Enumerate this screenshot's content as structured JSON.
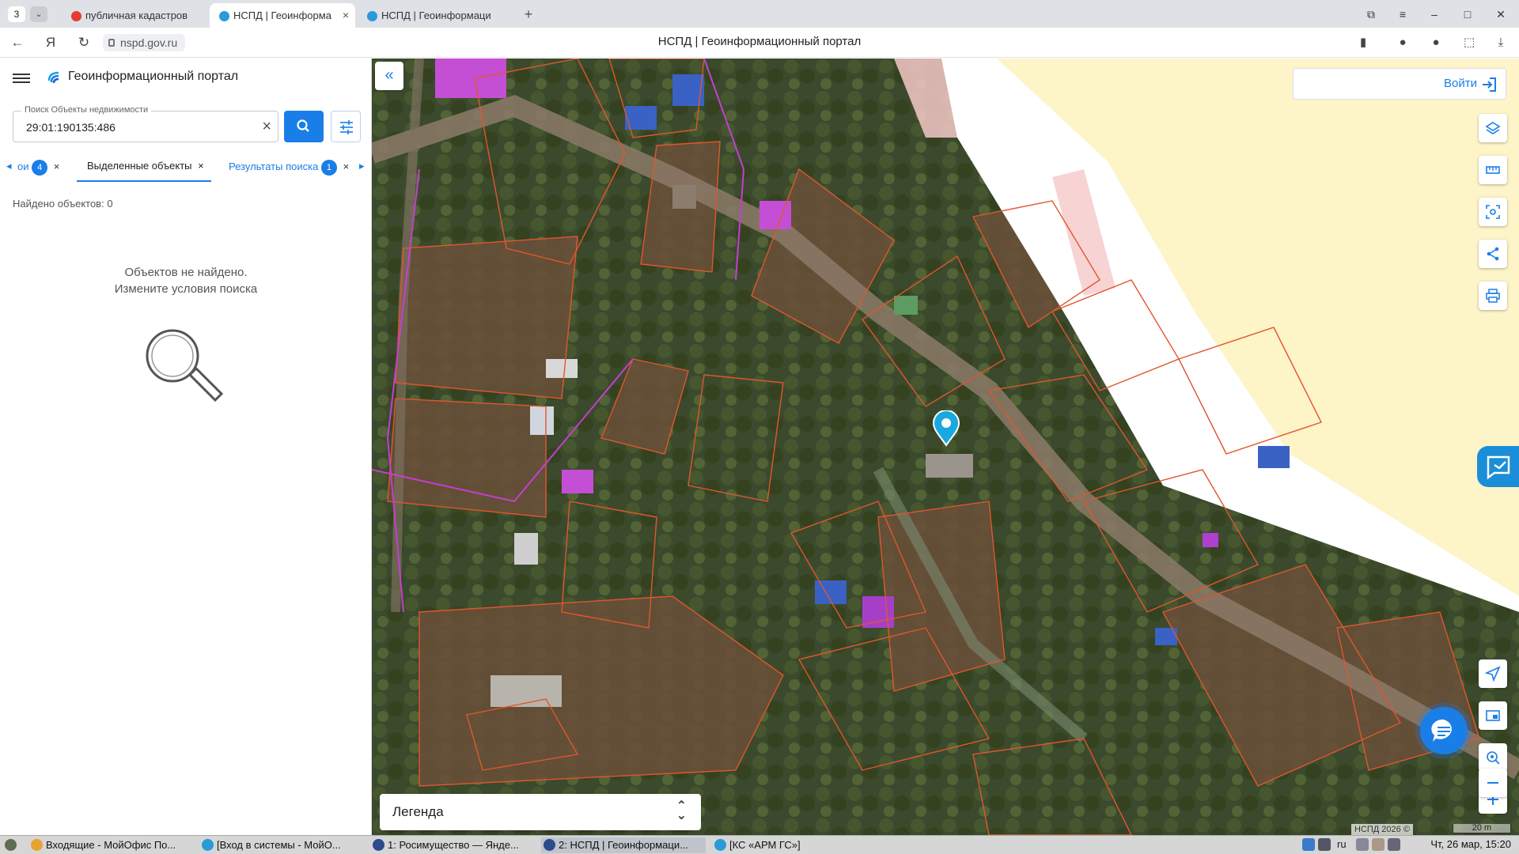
{
  "browser": {
    "tab_count": "3",
    "tabs": [
      {
        "title": "публичная кадастров"
      },
      {
        "title": "НСПД | Геоинформа"
      },
      {
        "title": "НСПД | Геоинформаци"
      }
    ],
    "url": "nspd.gov.ru",
    "page_title": "НСПД | Геоинформационный портал"
  },
  "sidebar": {
    "portal_title": "Геоинформационный портал",
    "search": {
      "label": "Поиск Объекты недвижимости",
      "value": "29:01:190135:486"
    },
    "tabs": [
      {
        "label": "ои",
        "badge": "4"
      },
      {
        "label": "Выделенные объекты"
      },
      {
        "label": "Результаты поиска",
        "badge": "1"
      }
    ],
    "found_text": "Найдено объектов: 0",
    "empty_line1": "Объектов не найдено.",
    "empty_line2": "Измените условия поиска"
  },
  "map": {
    "login_label": "Войти",
    "legend_label": "Легенда",
    "copyright": "НСПД 2026 ©",
    "scale_label": "20 m",
    "right_buttons": [
      "layers-icon",
      "ruler-icon",
      "select-area-icon",
      "share-icon",
      "print-icon"
    ],
    "bottom_buttons": [
      "locate-icon",
      "minimap-icon",
      "geo-search-icon",
      "zoom-in-icon",
      "zoom-out-icon"
    ]
  },
  "taskbar": {
    "items": [
      {
        "label": "Входящие - МойОфис По..."
      },
      {
        "label": "[Вход в системы - МойО..."
      },
      {
        "label": "1: Росимущество — Янде..."
      },
      {
        "label": "2: НСПД | Геоинформаци..."
      },
      {
        "label": "[КС «АРМ ГС»]"
      }
    ],
    "lang": "ru",
    "datetime": "Чт, 26 мар, 15:20"
  },
  "colors": {
    "accent": "#1a7ee8",
    "parcel_line": "#e0562e",
    "zone_pink": "#f6c8c8",
    "zone_yellow": "#fdf4c8"
  }
}
